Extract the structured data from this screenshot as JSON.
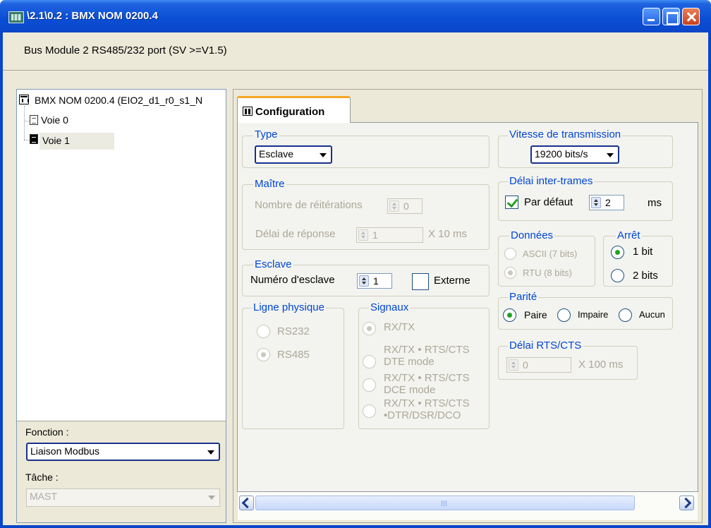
{
  "window": {
    "title": "\\2.1\\0.2 : BMX NOM 0200.4",
    "subtitle": "Bus Module 2 RS485/232 port (SV >=V1.5)",
    "icon": "app-module-icon"
  },
  "tree": {
    "root": "BMX NOM 0200.4 (EIO2_d1_r0_s1_N",
    "items": [
      {
        "label": "Voie 0",
        "selected": false
      },
      {
        "label": "Voie 1",
        "selected": true
      }
    ]
  },
  "left_bottom": {
    "fonction_label": "Fonction :",
    "fonction_value": "Liaison Modbus",
    "tache_label": "Tâche :",
    "tache_value": "MAST"
  },
  "tab": {
    "label": "Configuration"
  },
  "type": {
    "title": "Type",
    "value": "Esclave"
  },
  "maitre": {
    "title": "Maître",
    "retries_label": "Nombre de réitérations",
    "retries_value": "0",
    "response_label": "Délai de réponse",
    "response_value": "1",
    "response_unit": "X 10 ms"
  },
  "esclave": {
    "title": "Esclave",
    "number_label": "Numéro d'esclave",
    "number_value": "1",
    "externe_label": "Externe",
    "externe_checked": false
  },
  "ligne": {
    "title": "Ligne physique",
    "options": [
      {
        "label": "RS232",
        "selected": false
      },
      {
        "label": "RS485",
        "selected": true
      }
    ]
  },
  "signaux": {
    "title": "Signaux",
    "options": [
      {
        "label": "RX/TX",
        "selected": true
      },
      {
        "line1": "RX/TX • RTS/CTS",
        "line2": "DTE mode",
        "selected": false
      },
      {
        "line1": "RX/TX • RTS/CTS",
        "line2": "DCE mode",
        "selected": false
      },
      {
        "line1": "RX/TX • RTS/CTS",
        "line2": "•DTR/DSR/DCO",
        "selected": false
      }
    ]
  },
  "vitesse": {
    "title": "Vitesse de transmission",
    "value": "19200 bits/s"
  },
  "delai_inter": {
    "title": "Délai inter-trames",
    "default_label": "Par défaut",
    "default_checked": true,
    "value": "2",
    "unit": "ms"
  },
  "donnees": {
    "title": "Données",
    "options": [
      {
        "label": "ASCII (7 bits)",
        "selected": false
      },
      {
        "label": "RTU (8 bits)",
        "selected": true
      }
    ]
  },
  "arret": {
    "title": "Arrêt",
    "options": [
      {
        "label": "1 bit",
        "selected": true
      },
      {
        "label": "2 bits",
        "selected": false
      }
    ]
  },
  "parite": {
    "title": "Parité",
    "options": [
      {
        "label": "Paire",
        "selected": true
      },
      {
        "label": "Impaire",
        "selected": false
      },
      {
        "label": "Aucun",
        "selected": false
      }
    ]
  },
  "rts": {
    "title": "Délai RTS/CTS",
    "value": "0",
    "unit": "X 100 ms"
  },
  "colors": {
    "group_title": "#0046d5",
    "disabled_text": "#aca899",
    "radio_selected": "#21a121",
    "titlebar": "#0a46c8",
    "tab_accent": "#f5a623"
  }
}
